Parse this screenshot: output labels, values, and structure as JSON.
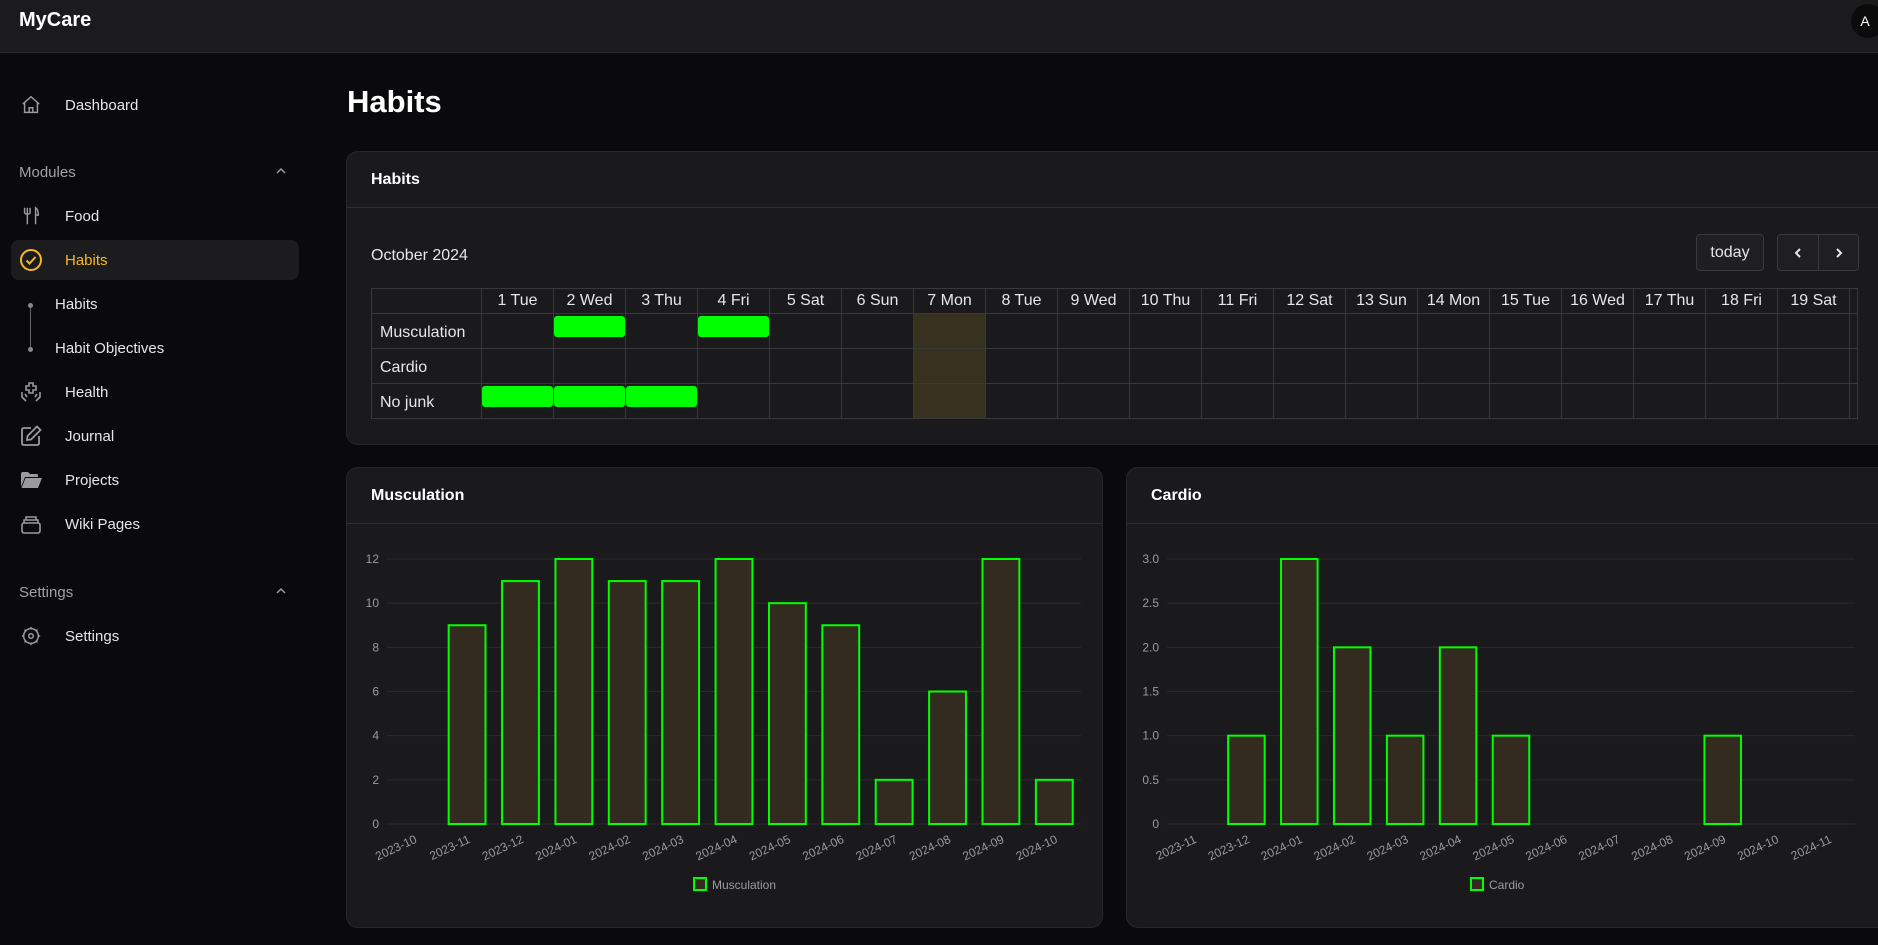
{
  "app": {
    "brand": "MyCare",
    "avatar_initial": "A"
  },
  "sidebar": {
    "dashboard": {
      "label": "Dashboard",
      "icon": "home-icon"
    },
    "modules_label": "Modules",
    "items": [
      {
        "label": "Food",
        "icon": "utensils-icon"
      },
      {
        "label": "Habits",
        "icon": "check-circle-icon",
        "active": true
      },
      {
        "label": "Health",
        "icon": "health-hands-icon"
      },
      {
        "label": "Journal",
        "icon": "edit-icon"
      },
      {
        "label": "Projects",
        "icon": "folder-open-icon"
      },
      {
        "label": "Wiki Pages",
        "icon": "archive-icon"
      }
    ],
    "habits_sub": [
      {
        "label": "Habits"
      },
      {
        "label": "Habit Objectives"
      }
    ],
    "settings_label": "Settings",
    "settings_item": {
      "label": "Settings",
      "icon": "gear-icon"
    }
  },
  "page": {
    "title": "Habits"
  },
  "habits_card": {
    "title": "Habits",
    "month": "October 2024",
    "today_button": "today",
    "prev_icon": "chevron-left-icon",
    "next_icon": "chevron-right-icon",
    "days": [
      "1 Tue",
      "2 Wed",
      "3 Thu",
      "4 Fri",
      "5 Sat",
      "6 Sun",
      "7 Mon",
      "8 Tue",
      "9 Wed",
      "10 Thu",
      "11 Fri",
      "12 Sat",
      "13 Sun",
      "14 Mon",
      "15 Tue",
      "16 Wed",
      "17 Thu",
      "18 Fri",
      "19 Sat"
    ],
    "today_index": 6,
    "done_color": "#00ff00",
    "today_color": "#36321f",
    "rows": [
      {
        "name": "Musculation",
        "done": [
          2,
          4
        ]
      },
      {
        "name": "Cardio",
        "done": []
      },
      {
        "name": "No junk",
        "done": [
          1,
          2,
          3
        ]
      }
    ]
  },
  "chart_data": [
    {
      "type": "bar",
      "title": "Musculation",
      "categories": [
        "2023-10",
        "2023-11",
        "2023-12",
        "2024-01",
        "2024-02",
        "2024-03",
        "2024-04",
        "2024-05",
        "2024-06",
        "2024-07",
        "2024-08",
        "2024-09",
        "2024-10"
      ],
      "series": [
        {
          "name": "Musculation",
          "values": [
            0,
            9,
            11,
            12,
            11,
            11,
            12,
            10,
            9,
            2,
            6,
            12,
            2
          ]
        }
      ],
      "yticks": [
        "0",
        "2",
        "4",
        "6",
        "8",
        "10",
        "12"
      ],
      "ylim": [
        0,
        12
      ],
      "grid": true,
      "legend": "bottom",
      "bar_border": "#00ff00",
      "bar_fill": "#332b1f"
    },
    {
      "type": "bar",
      "title": "Cardio",
      "categories": [
        "2023-11",
        "2023-12",
        "2024-01",
        "2024-02",
        "2024-03",
        "2024-04",
        "2024-05",
        "2024-06",
        "2024-07",
        "2024-08",
        "2024-09",
        "2024-10",
        "2024-11"
      ],
      "series": [
        {
          "name": "Cardio",
          "values": [
            0,
            1,
            3,
            2,
            1,
            2,
            1,
            0,
            0,
            0,
            1,
            0,
            0
          ]
        }
      ],
      "yticks": [
        "0",
        "0.5",
        "1.0",
        "1.5",
        "2.0",
        "2.5",
        "3.0"
      ],
      "ylim": [
        0,
        3
      ],
      "grid": true,
      "legend": "bottom",
      "bar_border": "#00ff00",
      "bar_fill": "#332b1f"
    }
  ]
}
